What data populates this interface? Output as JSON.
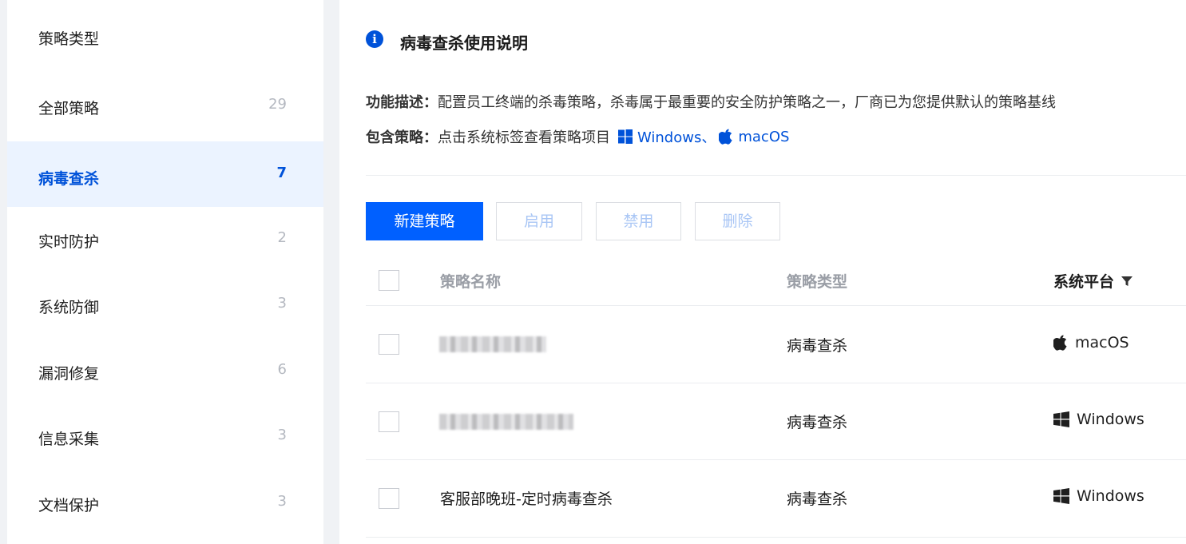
{
  "sidebar": {
    "header": "策略类型",
    "items": [
      {
        "label": "全部策略",
        "count": "29"
      },
      {
        "label": "病毒查杀",
        "count": "7"
      },
      {
        "label": "实时防护",
        "count": "2"
      },
      {
        "label": "系统防御",
        "count": "3"
      },
      {
        "label": "漏洞修复",
        "count": "6"
      },
      {
        "label": "信息采集",
        "count": "3"
      },
      {
        "label": "文档保护",
        "count": "3"
      }
    ],
    "active_index": 1
  },
  "info": {
    "icon": "info-icon",
    "title": "病毒查杀使用说明",
    "desc_key": "功能描述：",
    "desc_text": "配置员工终端的杀毒策略，杀毒属于最重要的安全防护策略之一，厂商已为您提供默认的策略基线",
    "include_key": "包含策略：",
    "include_text": "点击系统标签查看策略项目",
    "os_links": [
      {
        "icon": "windows-icon",
        "label": "Windows、"
      },
      {
        "icon": "apple-icon",
        "label": "macOS"
      }
    ]
  },
  "toolbar": {
    "new_label": "新建策略",
    "enable_label": "启用",
    "disable_label": "禁用",
    "delete_label": "删除"
  },
  "table": {
    "headers": {
      "name": "策略名称",
      "type": "策略类型",
      "platform": "系统平台"
    },
    "rows": [
      {
        "name": "",
        "type": "病毒查杀",
        "platform": "macOS",
        "platform_icon": "apple-icon"
      },
      {
        "name": "",
        "type": "病毒查杀",
        "platform": "Windows",
        "platform_icon": "windows-icon"
      },
      {
        "name": "客服部晚班-定时病毒查杀",
        "type": "病毒查杀",
        "platform": "Windows",
        "platform_icon": "windows-icon"
      }
    ]
  },
  "colors": {
    "accent": "#0052d9",
    "primary_button": "#0060ff",
    "active_bg": "#ebf3ff",
    "disabled_text": "#a9c6f5"
  }
}
